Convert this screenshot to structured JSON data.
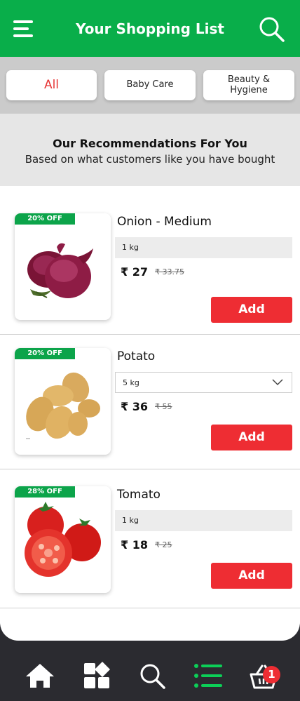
{
  "header": {
    "title": "Your Shopping List"
  },
  "tabs": [
    {
      "label": "All",
      "active": true
    },
    {
      "label": "Baby Care",
      "active": false
    },
    {
      "label": "Beauty & Hygiene",
      "active": false
    }
  ],
  "recommendations": {
    "title": "Our Recommendations For You",
    "subtitle": "Based on what customers like you have bought"
  },
  "products": [
    {
      "discount": "20% OFF",
      "name": "Onion - Medium",
      "quantity": "1 kg",
      "price": "₹ 27",
      "mrp": "₹ 33.75",
      "add_label": "Add"
    },
    {
      "discount": "20% OFF",
      "name": "Potato",
      "quantity": "5 kg",
      "price": "₹ 36",
      "mrp": "₹ 55",
      "add_label": "Add"
    },
    {
      "discount": "28% OFF",
      "name": "Tomato",
      "quantity": "1 kg",
      "price": "₹ 18",
      "mrp": "₹ 25",
      "add_label": "Add"
    }
  ],
  "bottom_nav": {
    "items": [
      "home-icon",
      "categories-icon",
      "search-icon",
      "list-icon",
      "basket-icon"
    ],
    "active": "list-icon",
    "cart_count": "1"
  },
  "colors": {
    "brand_green": "#09ae4a",
    "add_red": "#ee2d33",
    "nav_bg": "#2b2b30"
  }
}
